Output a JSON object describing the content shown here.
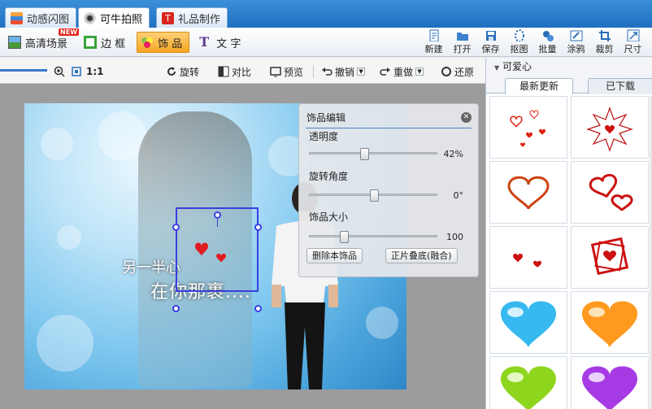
{
  "tabs": [
    {
      "label": "动感闪图",
      "icon": "film-strip-icon",
      "active": false
    },
    {
      "label": "可牛拍照",
      "icon": "camera-icon",
      "active": true
    },
    {
      "label": "礼品制作",
      "icon": "gift-icon",
      "active": false
    }
  ],
  "toolbar": {
    "items": [
      {
        "label": "高清场景",
        "icon": "scene-icon",
        "badge": "NEW"
      },
      {
        "label": "边 框",
        "icon": "frame-icon"
      },
      {
        "label": "饰 品",
        "icon": "flower-icon",
        "active": true
      },
      {
        "label": "文 字",
        "icon": "text-t-icon"
      }
    ],
    "tools": [
      {
        "label": "新建",
        "icon": "new-file-icon"
      },
      {
        "label": "打开",
        "icon": "open-folder-icon"
      },
      {
        "label": "保存",
        "icon": "save-disk-icon"
      },
      {
        "label": "抠图",
        "icon": "cutout-icon"
      },
      {
        "label": "批量",
        "icon": "batch-gear-icon"
      },
      {
        "label": "涂鸦",
        "icon": "brush-icon"
      },
      {
        "label": "裁剪",
        "icon": "crop-icon"
      },
      {
        "label": "尺寸",
        "icon": "resize-icon"
      }
    ]
  },
  "subbar": {
    "zoom": "1:1",
    "rotate": "旋转",
    "contrast": "对比",
    "preview": "预览",
    "undo": "撤销",
    "redo": "重做",
    "restore": "还原"
  },
  "photo": {
    "overlay_line1": "另一半心",
    "overlay_line2": "在你那裹...."
  },
  "panel": {
    "title": "饰品编辑",
    "opacity_label": "透明度",
    "opacity_value": "42%",
    "opacity": 0.42,
    "rotate_label": "旋转角度",
    "rotate_value": "0°",
    "rotate_fraction": 0.5,
    "size_label": "饰品大小",
    "size_value": "100",
    "size_fraction": 0.25,
    "delete_button": "删除本饰品",
    "merge_button": "正片叠底(融合)"
  },
  "right_panel": {
    "category": "可爱心",
    "tabs": [
      "最新更新",
      "已下载"
    ],
    "items": [
      {
        "name": "scattered-small-hearts"
      },
      {
        "name": "starburst-heart"
      },
      {
        "name": "red-outline-heart"
      },
      {
        "name": "two-outline-hearts"
      },
      {
        "name": "tiny-red-hearts"
      },
      {
        "name": "framed-heart"
      },
      {
        "name": "blue-glossy-heart",
        "color": "#35b9ee"
      },
      {
        "name": "orange-glossy-heart",
        "color": "#ff9a1f"
      },
      {
        "name": "green-glossy-heart",
        "color": "#8ed61e"
      },
      {
        "name": "purple-glossy-heart",
        "color": "#a63be6"
      }
    ]
  },
  "colors": {
    "accent_blue": "#2a77c6",
    "active_orange": "#f6a623",
    "selection_blue": "#3a3fe0"
  }
}
